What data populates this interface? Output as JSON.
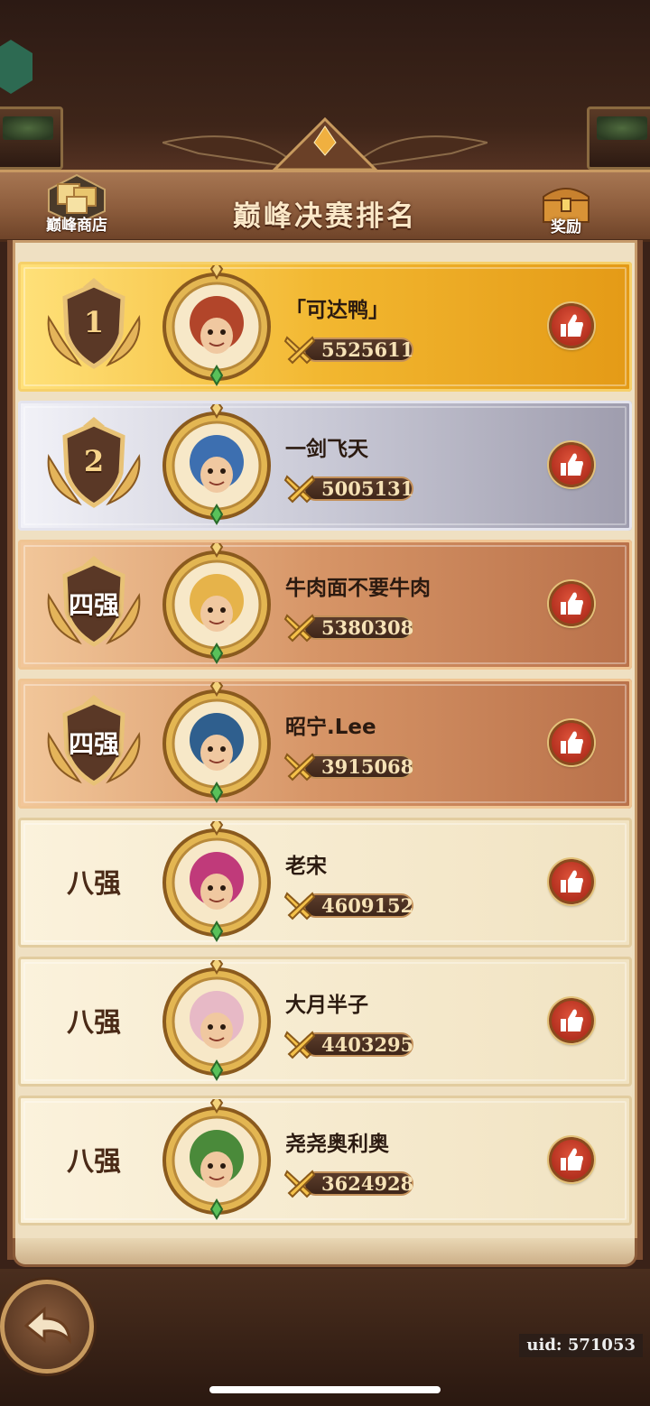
{
  "header": {
    "title": "巅峰决赛排名",
    "shop_label": "巅峰商店",
    "reward_label": "奖励"
  },
  "rankings": [
    {
      "rank": "1",
      "style": "gold",
      "name": "「可达鸭」",
      "power": "5525611"
    },
    {
      "rank": "2",
      "style": "silver",
      "name": "一剑飞天",
      "power": "5005131"
    },
    {
      "rank": "四强",
      "style": "bronze",
      "name": "牛肉面不要牛肉",
      "power": "5380308"
    },
    {
      "rank": "四强",
      "style": "bronze",
      "name": "昭宁.Lee",
      "power": "3915068"
    },
    {
      "rank": "八强",
      "style": "plain",
      "name": "老宋",
      "power": "4609152"
    },
    {
      "rank": "八强",
      "style": "plain",
      "name": "大月半子",
      "power": "4403295"
    },
    {
      "rank": "八强",
      "style": "plain",
      "name": "尧尧奥利奥",
      "power": "3624928"
    }
  ],
  "footer": {
    "uid": "uid: 571053"
  },
  "colors": {
    "accent": "#c79a5e",
    "like": "#c43a27",
    "frame": "#7a4c30"
  }
}
